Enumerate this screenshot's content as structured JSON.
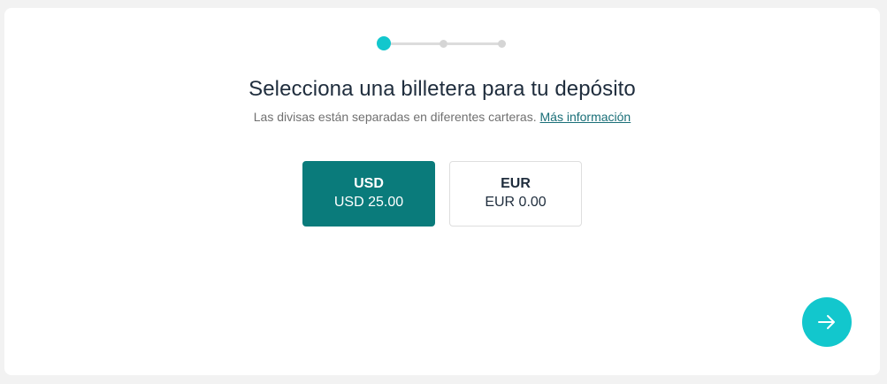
{
  "stepper": {
    "total_steps": 3,
    "current_step": 1
  },
  "header": {
    "title": "Selecciona una billetera para tu depósito",
    "subtitle": "Las divisas están separadas en diferentes carteras.",
    "more_info_link": "Más información"
  },
  "wallets": [
    {
      "code": "USD",
      "balance": "USD 25.00",
      "selected": true
    },
    {
      "code": "EUR",
      "balance": "EUR 0.00",
      "selected": false
    }
  ],
  "actions": {
    "next_icon": "arrow-right-icon"
  },
  "colors": {
    "accent": "#12c7cd",
    "selected_wallet": "#0a7b7b",
    "link": "#1a6f78",
    "title": "#1f2d3d",
    "subtitle": "#707070"
  }
}
